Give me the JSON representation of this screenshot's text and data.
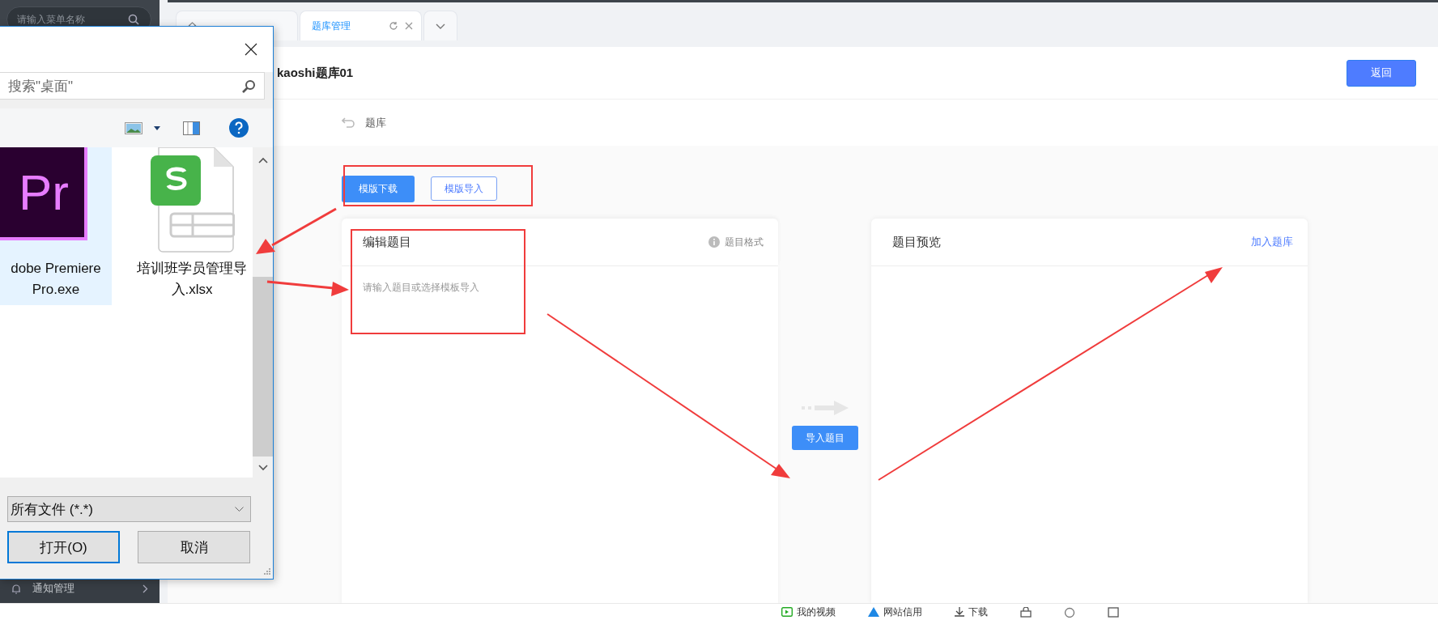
{
  "sidebar": {
    "search_placeholder": "请输入菜单名称",
    "items": [
      {
        "label": "通知管理"
      }
    ]
  },
  "tabs": [
    {
      "selected": false,
      "kind": "home"
    },
    {
      "label": "题库管理",
      "selected": true,
      "kind": "page"
    }
  ],
  "header": {
    "title": "kaoshi题库01",
    "back_button": "返回"
  },
  "breadcrumb": "题库",
  "template_buttons": [
    {
      "label": "模版下载",
      "kind": "primary"
    },
    {
      "label": "模版导入",
      "kind": "outline"
    }
  ],
  "editor": {
    "title": "编辑题目",
    "format_link": "题目格式",
    "placeholder": "请输入题目或选择模板导入"
  },
  "import_button": "导入题目",
  "preview": {
    "title": "题目预览",
    "add_link": "加入题库"
  },
  "file_dialog": {
    "search_placeholder": "搜索\"桌面\"",
    "files": [
      {
        "name": "dobe Premiere Pro.exe",
        "kind": "app",
        "icon_text": "Pr",
        "selected": true
      },
      {
        "name": "培训班学员管理导入.xlsx",
        "kind": "spreadsheet",
        "selected": false
      }
    ],
    "file_type": "所有文件 (*.*)",
    "buttons": [
      {
        "label": "打开(O)",
        "focused": true
      },
      {
        "label": "取消",
        "focused": false
      }
    ]
  },
  "bottom_bar": [
    {
      "label": "我的视频",
      "kind": "video"
    },
    {
      "label": "网站信用",
      "kind": "credit"
    },
    {
      "label": "下载",
      "kind": "download"
    }
  ]
}
